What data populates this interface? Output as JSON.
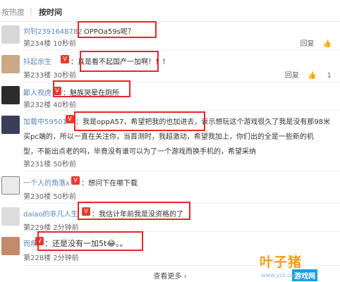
{
  "sort": {
    "heat": "按热度",
    "sep": "|",
    "time": "按时间"
  },
  "comments": [
    {
      "user": "刘钊2391648782",
      "badge": "",
      "text": "OPPOa59s呢？",
      "floor": "第234楼",
      "time": "10秒前",
      "reply": "回复",
      "likes": ""
    },
    {
      "user": "抖起余生",
      "badge": "V",
      "text": "：真是看不起国产一加啊！！！",
      "floor": "第233楼",
      "time": "30秒前",
      "reply": "回复",
      "likes": "1"
    },
    {
      "user": "鄙人视虎",
      "badge": "V",
      "text": "：魅族哭晕在厕所",
      "floor": "第232楼",
      "time": "40秒前",
      "reply": "",
      "likes": ""
    },
    {
      "user": "加载中59501",
      "badge": "V",
      "text_lines": [
        "：我是oppA57，希望把我的也加进去，表示想玩这个游戏很久了我是没有那98米",
        "买pc端的，所以一直在关注你，当首测时，我超激动，希望我加上，你们出的全是一些新的机",
        "型，不能出点老的吗，毕竟没有谁可以为了一个游戏而换手机的，希望采纳"
      ],
      "floor": "第231楼",
      "time": "50秒前",
      "reply": "",
      "likes": ""
    },
    {
      "user": "一个人的角落x",
      "badge": "V",
      "text": "：想问下在哪下载",
      "floor": "第230楼",
      "time": "50秒前",
      "reply": "",
      "likes": ""
    },
    {
      "user": "daiao的非凡人生",
      "badge": "V",
      "text": "：我估计年前我是没资格的了",
      "floor": "第229楼",
      "time": "2分钟前",
      "reply": "",
      "likes": ""
    },
    {
      "user": "而疾",
      "badge": "V",
      "text": "：还是没有一加5t😂。。",
      "floor": "第228楼",
      "time": "2分钟前",
      "reply": "",
      "likes": ""
    }
  ],
  "more": "查看更多 ›",
  "watermark": {
    "main": "叶子猪",
    "sub": "游戏网",
    "url": "www.yzz.cn"
  },
  "colors": {
    "username": "#5a86b8",
    "highlight": "#e8262b",
    "badge": "#e53d2f"
  }
}
